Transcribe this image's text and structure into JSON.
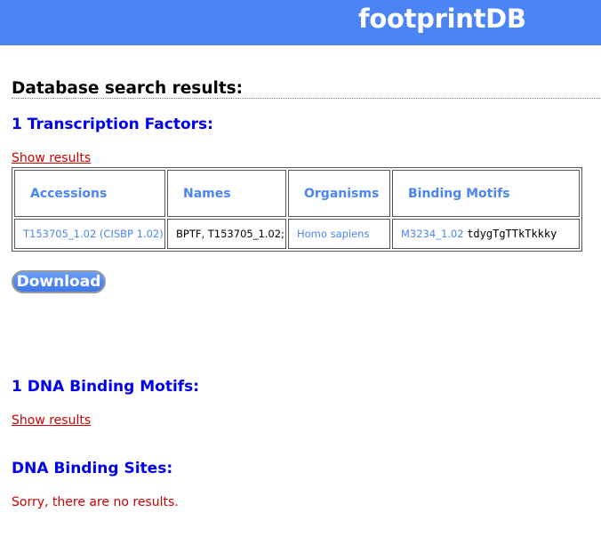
{
  "header": {
    "title": "footprintDB"
  },
  "page": {
    "heading": "Database search results:"
  },
  "transcription_factors": {
    "title": "1 Transcription Factors:",
    "show_link": "Show results",
    "columns": [
      "Accessions",
      "Names",
      "Organisms",
      "Binding Motifs"
    ],
    "rows": [
      {
        "accession": "T153705_1.02 (CISBP 1.02)",
        "names": "BPTF, T153705_1.02;",
        "organism": "Homo sapiens",
        "motif_id": "M3234_1.02",
        "motif_seq": "tdygTgTTkTkkky"
      }
    ],
    "download_label": "Download"
  },
  "dna_binding_motifs": {
    "title": "1 DNA Binding Motifs:",
    "show_link": "Show results"
  },
  "dna_binding_sites": {
    "title": "DNA Binding Sites:",
    "no_results": "Sorry, there are no results."
  },
  "colors": {
    "header_bg": "#4b84f5",
    "section_title": "#0000ee",
    "link_red": "#cc0000",
    "table_link": "#4b84f5"
  }
}
